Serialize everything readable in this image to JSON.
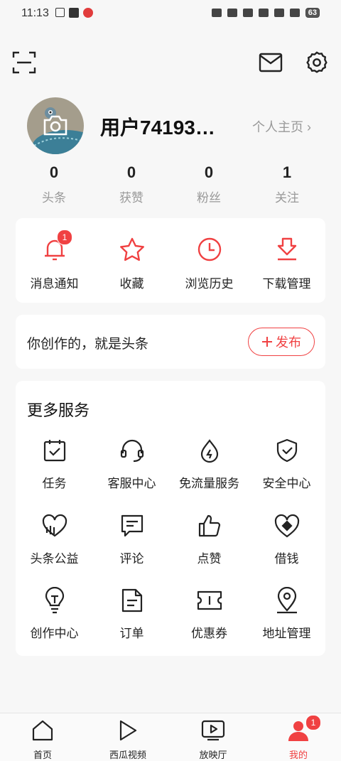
{
  "status_bar": {
    "time": "11:13",
    "battery": "63"
  },
  "profile": {
    "username": "用户74193…",
    "homepage_link": "个人主页 ›",
    "stats": [
      {
        "value": "0",
        "label": "头条"
      },
      {
        "value": "0",
        "label": "获赞"
      },
      {
        "value": "0",
        "label": "粉丝"
      },
      {
        "value": "1",
        "label": "关注"
      }
    ]
  },
  "quick_actions": [
    {
      "label": "消息通知",
      "icon": "bell-icon",
      "badge": "1"
    },
    {
      "label": "收藏",
      "icon": "star-icon"
    },
    {
      "label": "浏览历史",
      "icon": "clock-icon"
    },
    {
      "label": "下载管理",
      "icon": "download-icon"
    }
  ],
  "create": {
    "text": "你创作的，就是头条",
    "publish_label": "发布"
  },
  "services": {
    "title": "更多服务",
    "items": [
      {
        "label": "任务",
        "icon": "task-calendar-icon"
      },
      {
        "label": "客服中心",
        "icon": "headset-icon"
      },
      {
        "label": "免流量服务",
        "icon": "drop-icon"
      },
      {
        "label": "安全中心",
        "icon": "shield-icon"
      },
      {
        "label": "头条公益",
        "icon": "charity-heart-icon"
      },
      {
        "label": "评论",
        "icon": "comment-icon"
      },
      {
        "label": "点赞",
        "icon": "thumbs-up-icon"
      },
      {
        "label": "借钱",
        "icon": "loan-heart-icon"
      },
      {
        "label": "创作中心",
        "icon": "lightbulb-icon"
      },
      {
        "label": "订单",
        "icon": "order-doc-icon"
      },
      {
        "label": "优惠券",
        "icon": "coupon-icon"
      },
      {
        "label": "地址管理",
        "icon": "location-pin-icon"
      }
    ]
  },
  "bottom_nav": [
    {
      "label": "首页",
      "icon": "home-icon"
    },
    {
      "label": "西瓜视频",
      "icon": "play-icon"
    },
    {
      "label": "放映厅",
      "icon": "tv-play-icon"
    },
    {
      "label": "我的",
      "icon": "user-icon",
      "badge": "1",
      "active": true
    }
  ],
  "colors": {
    "accent": "#f04142",
    "background": "#f7f7f7",
    "card": "#ffffff"
  }
}
